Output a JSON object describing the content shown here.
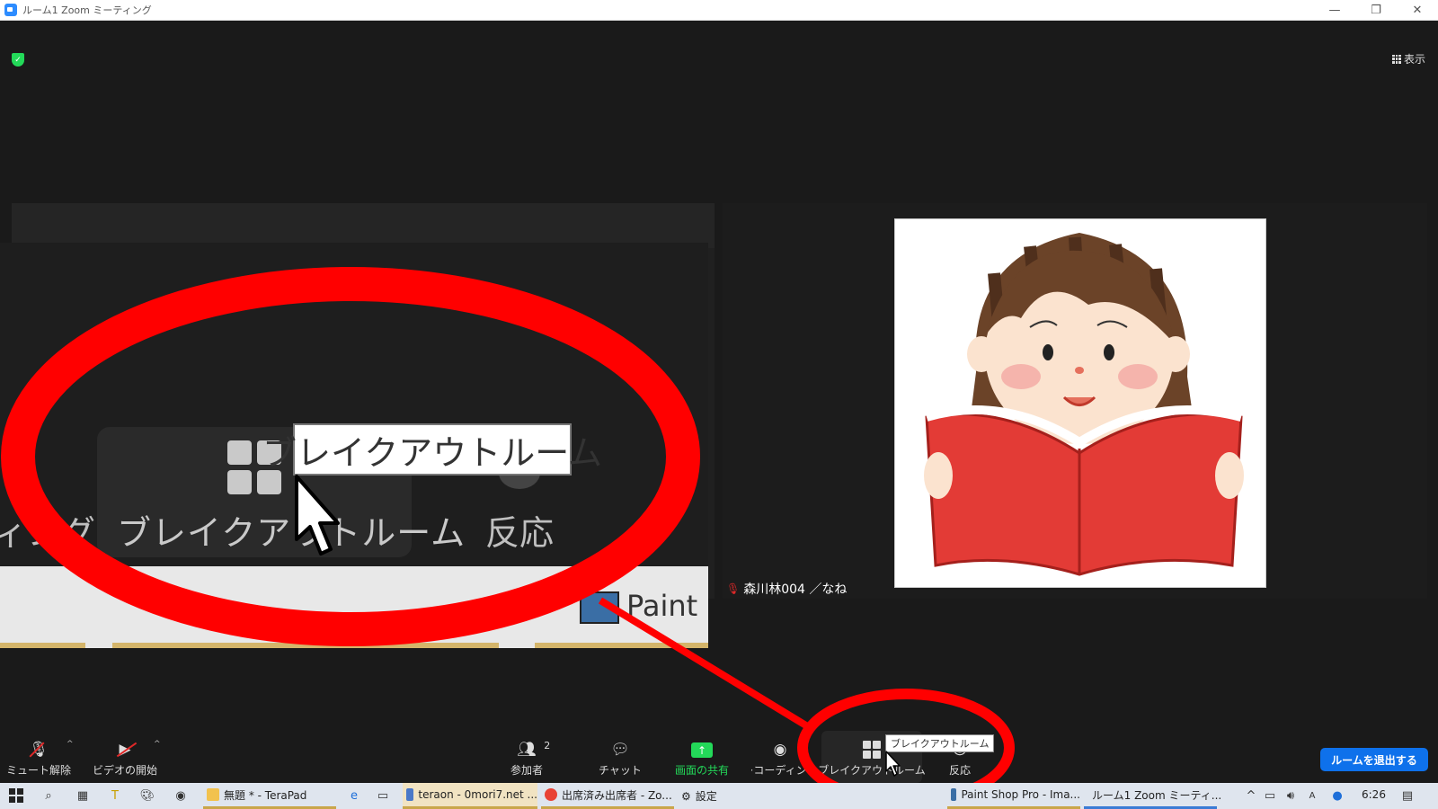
{
  "window": {
    "title": "ルーム1   Zoom ミーティング",
    "controls": {
      "minimize": "—",
      "restore": "❐",
      "close": "✕"
    }
  },
  "meeting": {
    "view_label": "表示",
    "participant_name": "森川林004 ／なね"
  },
  "zoom_inset": {
    "breakout_label": "ブレイクアウトルーム",
    "tooltip": "ブレイクアウトルーム",
    "reactions_label": "反応",
    "partial_left_label": "ィング",
    "taskbar_text": "Paint Sh"
  },
  "toolbar": {
    "mute_label": "ミュート解除",
    "video_label": "ビデオの開始",
    "participants_label": "参加者",
    "participants_count": "2",
    "chat_label": "チャット",
    "share_label": "画面の共有",
    "record_label": "レコーディング",
    "breakout_label": "ブレイクアウトルーム",
    "reactions_label": "反応",
    "tooltip": "ブレイクアウトルーム",
    "leave_label": "ルームを退出する"
  },
  "taskbar": {
    "items": [
      {
        "label": "無題 * - TeraPad"
      },
      {
        "label": "teraon - 0mori7.net ..."
      },
      {
        "label": "出席済み出席者 - Zo..."
      },
      {
        "label": "設定"
      },
      {
        "label": "Paint Shop Pro - Ima..."
      },
      {
        "label": "ルーム1  Zoom ミーティ..."
      }
    ],
    "clock": "6:26"
  },
  "colors": {
    "accent_blue": "#0e71eb",
    "share_green": "#23d959",
    "annotation_red": "#ff0000",
    "mute_red": "#e02828"
  }
}
